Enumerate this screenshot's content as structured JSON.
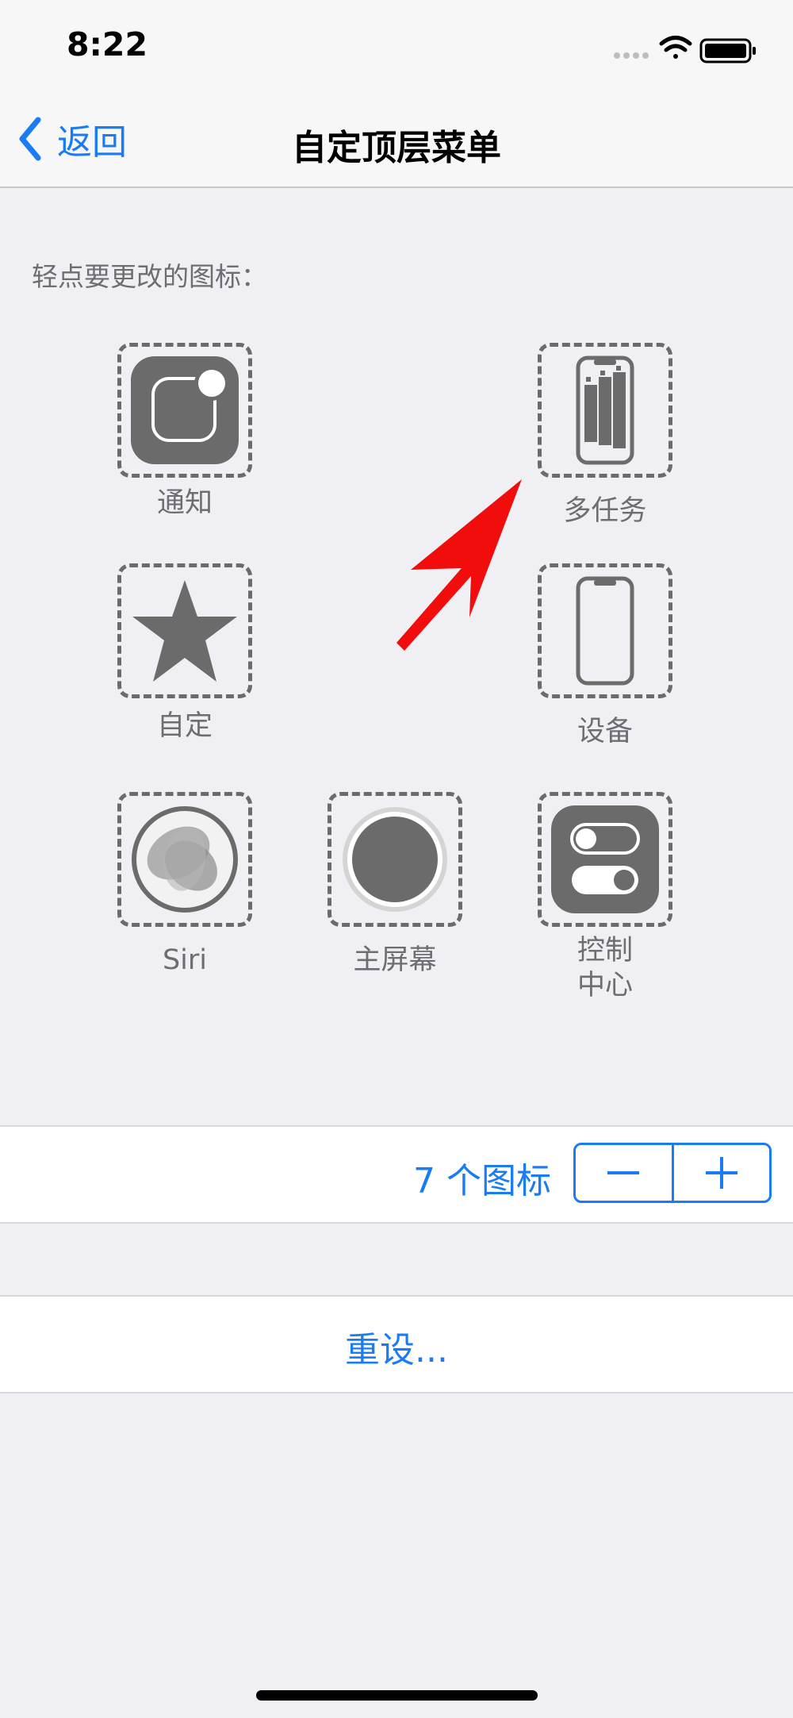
{
  "status_bar": {
    "time": "8:22"
  },
  "nav": {
    "back_label": "返回",
    "title": "自定顶层菜单"
  },
  "hint": "轻点要更改的图标：",
  "icons": [
    {
      "label": "通知",
      "icon": "notification-icon"
    },
    {
      "label": "多任务",
      "icon": "multitask-icon"
    },
    {
      "label": "自定",
      "icon": "star-icon"
    },
    {
      "label": "设备",
      "icon": "device-icon"
    },
    {
      "label": "Siri",
      "icon": "siri-icon"
    },
    {
      "label": "主屏幕",
      "icon": "home-icon"
    },
    {
      "label": "控制\n中心",
      "icon": "control-center-icon"
    }
  ],
  "count": {
    "text": "7 个图标",
    "minus": "−",
    "plus": "+"
  },
  "reset_label": "重设...",
  "colors": {
    "accent": "#1a7cf5",
    "icon_gray": "#6b6b6b",
    "background": "#efeff4",
    "arrow": "#f20d0d"
  }
}
